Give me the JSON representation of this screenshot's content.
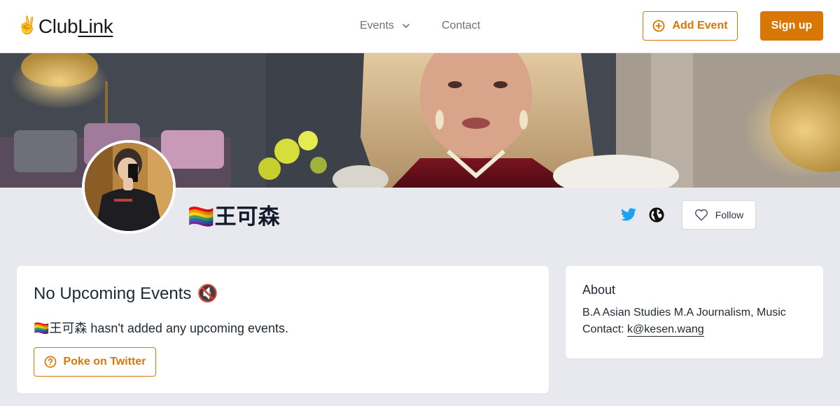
{
  "header": {
    "logo_emoji": "✌️",
    "logo_club": "Club",
    "logo_link": "Link",
    "nav": {
      "events_label": "Events",
      "contact_label": "Contact"
    },
    "add_event_label": "Add Event",
    "sign_up_label": "Sign up"
  },
  "profile": {
    "name": "🏳️‍🌈王可森",
    "follow_label": "Follow",
    "social_icons": [
      "twitter-icon",
      "globe-icon"
    ]
  },
  "events_card": {
    "title": "No Upcoming Events",
    "title_icon": "🔇",
    "description": "🏳️‍🌈王可森 hasn't added any upcoming events.",
    "poke_label": "Poke on Twitter"
  },
  "about_card": {
    "title": "About",
    "bio": "B.A Asian Studies M.A Journalism, Music",
    "contact_prefix": "Contact:",
    "contact_email": "k@kesen.wang"
  },
  "colors": {
    "accent": "#d97706",
    "twitter": "#1da1f2",
    "page_bg": "#e8e9ee"
  }
}
